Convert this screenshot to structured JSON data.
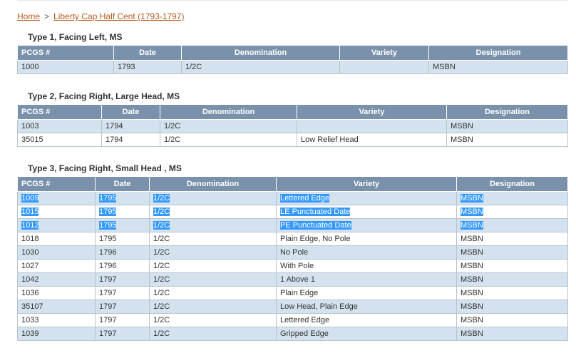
{
  "breadcrumb": {
    "home": "Home",
    "separator": ">",
    "current": "Liberty Cap Half Cent (1793-1797)"
  },
  "headers": [
    "PCGS #",
    "Date",
    "Denomination",
    "Variety",
    "Designation"
  ],
  "sections": [
    {
      "title": "Type 1, Facing Left, MS",
      "rows": [
        [
          "1000",
          "1793",
          "1/2C",
          "",
          "MSBN"
        ]
      ]
    },
    {
      "title": "Type 2, Facing Right, Large Head, MS",
      "rows": [
        [
          "1003",
          "1794",
          "1/2C",
          "",
          "MSBN"
        ],
        [
          "35015",
          "1794",
          "1/2C",
          "Low Relief Head",
          "MSBN"
        ]
      ]
    },
    {
      "title": "Type 3, Facing Right, Small Head , MS",
      "rows": [
        [
          "1009",
          "1795",
          "1/2C",
          "Lettered Edge",
          "MSBN"
        ],
        [
          "1015",
          "1795",
          "1/2C",
          "LE Punctuated Date",
          "MSBN"
        ],
        [
          "1012",
          "1795",
          "1/2C",
          "PE Punctuated Date",
          "MSBN"
        ],
        [
          "1018",
          "1795",
          "1/2C",
          "Plain Edge, No Pole",
          "MSBN"
        ],
        [
          "1030",
          "1796",
          "1/2C",
          "No Pole",
          "MSBN"
        ],
        [
          "1027",
          "1796",
          "1/2C",
          "With Pole",
          "MSBN"
        ],
        [
          "1042",
          "1797",
          "1/2C",
          "1 Above 1",
          "MSBN"
        ],
        [
          "1036",
          "1797",
          "1/2C",
          "Plain Edge",
          "MSBN"
        ],
        [
          "35107",
          "1797",
          "1/2C",
          "Low Head, Plain Edge",
          "MSBN"
        ],
        [
          "1033",
          "1797",
          "1/2C",
          "Lettered Edge",
          "MSBN"
        ],
        [
          "1039",
          "1797",
          "1/2C",
          "Gripped Edge",
          "MSBN"
        ]
      ]
    }
  ],
  "colors": {
    "header_bg": "#7a91ab",
    "row_alt": "#d4e2ef",
    "link": "#b35a1e",
    "selection": "#3399ff"
  }
}
